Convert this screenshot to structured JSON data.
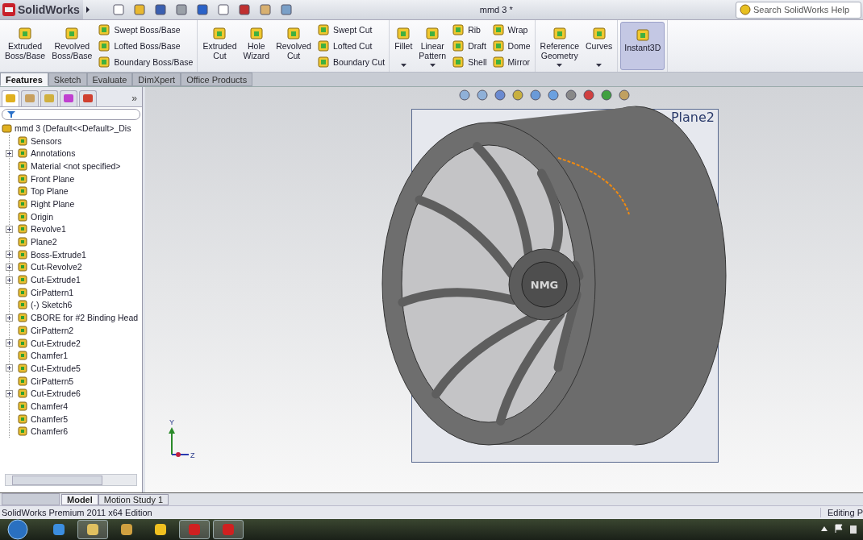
{
  "title_bar": {
    "logo": "SolidWorks",
    "document_title": "mmd 3 *",
    "search": {
      "placeholder": "Search SolidWorks Help"
    }
  },
  "ribbon": {
    "groups": [
      {
        "items": [
          {
            "kind": "large",
            "label": "Extruded\nBoss/Base",
            "dropdown": false,
            "pressed": false
          },
          {
            "kind": "large",
            "label": "Revolved\nBoss/Base",
            "dropdown": false,
            "pressed": false
          },
          {
            "kind": "stack",
            "labels": [
              "Swept Boss/Base",
              "Lofted Boss/Base",
              "Boundary Boss/Base"
            ]
          }
        ]
      },
      {
        "items": [
          {
            "kind": "large",
            "label": "Extruded\nCut",
            "dropdown": false,
            "pressed": false
          },
          {
            "kind": "large",
            "label": "Hole\nWizard",
            "dropdown": false,
            "pressed": false
          },
          {
            "kind": "large",
            "label": "Revolved\nCut",
            "dropdown": false,
            "pressed": false
          },
          {
            "kind": "stack",
            "labels": [
              "Swept Cut",
              "Lofted Cut",
              "Boundary Cut"
            ]
          }
        ]
      },
      {
        "items": [
          {
            "kind": "large",
            "label": "Fillet",
            "dropdown": true,
            "pressed": false
          },
          {
            "kind": "large",
            "label": "Linear\nPattern",
            "dropdown": true,
            "pressed": false
          },
          {
            "kind": "stack",
            "labels": [
              "Rib",
              "Draft",
              "Shell"
            ]
          },
          {
            "kind": "stack",
            "labels": [
              "Wrap",
              "Dome",
              "Mirror"
            ]
          }
        ]
      },
      {
        "items": [
          {
            "kind": "large",
            "label": "Reference\nGeometry",
            "dropdown": true,
            "pressed": false
          },
          {
            "kind": "large",
            "label": "Curves",
            "dropdown": true,
            "pressed": false
          }
        ]
      },
      {
        "items": [
          {
            "kind": "large",
            "label": "Instant3D",
            "dropdown": false,
            "pressed": true
          }
        ]
      }
    ]
  },
  "command_tabs": [
    {
      "label": "Features",
      "selected": true
    },
    {
      "label": "Sketch",
      "selected": false
    },
    {
      "label": "Evaluate",
      "selected": false
    },
    {
      "label": "DimXpert",
      "selected": false
    },
    {
      "label": "Office Products",
      "selected": false
    }
  ],
  "feature_manager": {
    "panel_tabs": [
      {
        "selected": true
      },
      {
        "selected": false
      },
      {
        "selected": false
      },
      {
        "selected": false
      },
      {
        "selected": false
      }
    ],
    "more": "»",
    "tree": {
      "label": "mmd 3  (Default<<Default>_Dis",
      "children": [
        {
          "label": "Sensors",
          "expandable": false
        },
        {
          "label": "Annotations",
          "expandable": true
        },
        {
          "label": "Material <not specified>",
          "expandable": false
        },
        {
          "label": "Front Plane",
          "expandable": false
        },
        {
          "label": "Top Plane",
          "expandable": false
        },
        {
          "label": "Right Plane",
          "expandable": false
        },
        {
          "label": "Origin",
          "expandable": false
        },
        {
          "label": "Revolve1",
          "expandable": true
        },
        {
          "label": "Plane2",
          "expandable": false
        },
        {
          "label": "Boss-Extrude1",
          "expandable": true
        },
        {
          "label": "Cut-Revolve2",
          "expandable": true
        },
        {
          "label": "Cut-Extrude1",
          "expandable": true
        },
        {
          "label": "CirPattern1",
          "expandable": false
        },
        {
          "label": "(-) Sketch6",
          "expandable": false
        },
        {
          "label": "CBORE for #2 Binding Head",
          "expandable": true
        },
        {
          "label": "CirPattern2",
          "expandable": false
        },
        {
          "label": "Cut-Extrude2",
          "expandable": true
        },
        {
          "label": "Chamfer1",
          "expandable": false
        },
        {
          "label": "Cut-Extrude5",
          "expandable": true
        },
        {
          "label": "CirPattern5",
          "expandable": false
        },
        {
          "label": "Cut-Extrude6",
          "expandable": true
        },
        {
          "label": "Chamfer4",
          "expandable": false
        },
        {
          "label": "Chamfer5",
          "expandable": false
        },
        {
          "label": "Chamfer6",
          "expandable": false
        }
      ]
    }
  },
  "viewport": {
    "plane_label": "Plane2",
    "hub_text": "NMG",
    "triad": {
      "y_label": "Y",
      "z_label": "Z"
    }
  },
  "model_tabs": [
    {
      "label": "Model",
      "selected": true
    },
    {
      "label": "Motion Study 1",
      "selected": false
    }
  ],
  "status_bar": {
    "edition": "SolidWorks Premium 2011 x64 Edition",
    "mode": "Editing P"
  },
  "taskbar": {
    "items": [
      {
        "running": false
      },
      {
        "running": true
      },
      {
        "running": false
      },
      {
        "running": false
      },
      {
        "running": true
      },
      {
        "running": true
      }
    ]
  }
}
